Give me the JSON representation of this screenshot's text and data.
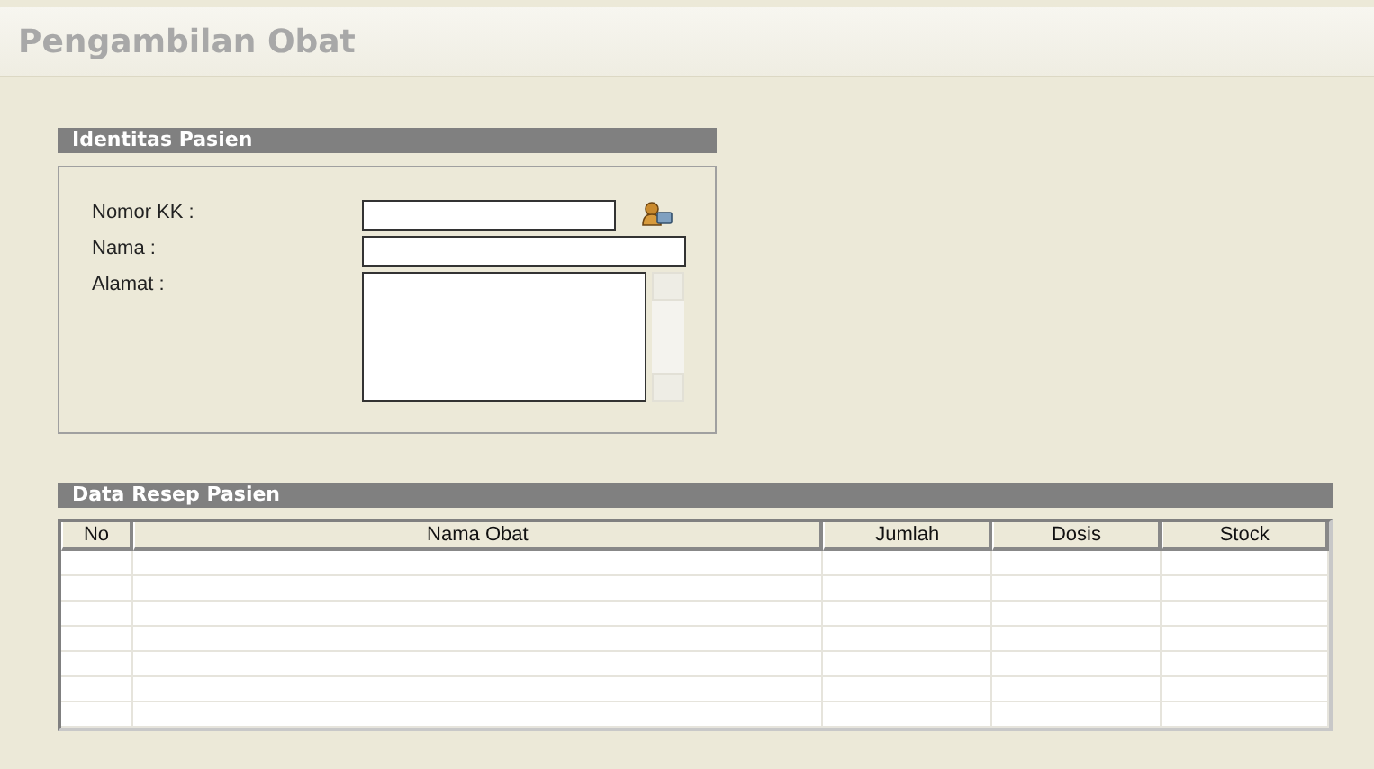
{
  "page": {
    "title": "Pengambilan Obat"
  },
  "patient_identity": {
    "title": "Identitas Pasien",
    "fields": [
      {
        "kind": "lookup",
        "label": "Nomor KK :"
      },
      {
        "kind": "text",
        "label": "Nama :"
      },
      {
        "kind": "textarea",
        "label": "Alamat :"
      }
    ]
  },
  "prescription": {
    "title": "Data Resep Pasien",
    "table": {
      "columns": [
        "No",
        "Nama Obat",
        "Jumlah",
        "Dosis",
        "Stock"
      ]
    }
  }
}
